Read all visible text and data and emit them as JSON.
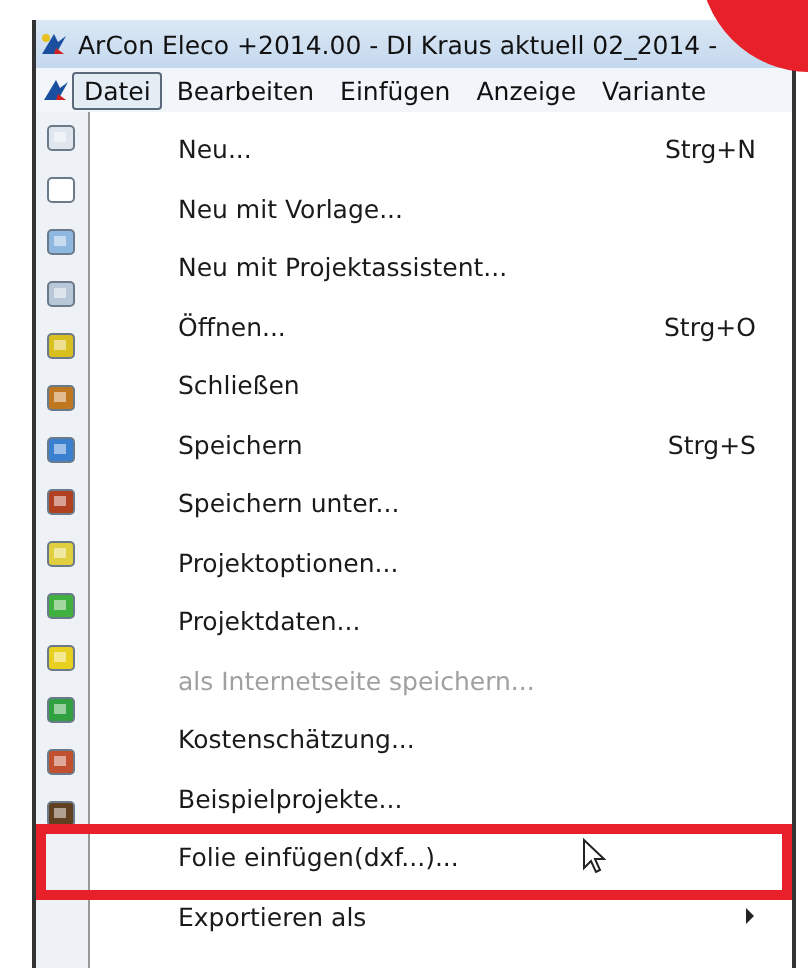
{
  "window": {
    "title": "ArCon Eleco  +2014.00 - DI Kraus aktuell 02_2014 -"
  },
  "menubar": [
    {
      "label": "Datei",
      "selected": true
    },
    {
      "label": "Bearbeiten",
      "selected": false
    },
    {
      "label": "Einfügen",
      "selected": false
    },
    {
      "label": "Anzeige",
      "selected": false
    },
    {
      "label": "Variante",
      "selected": false
    }
  ],
  "menu": [
    {
      "label": "Neu...",
      "shortcut": "Strg+N",
      "disabled": false,
      "highlighted": false,
      "submenu": false
    },
    {
      "label": "Neu mit Vorlage...",
      "disabled": false,
      "highlighted": false,
      "submenu": false
    },
    {
      "label": "Neu mit Projektassistent...",
      "disabled": false,
      "highlighted": false,
      "submenu": false
    },
    {
      "label": "Öffnen...",
      "shortcut": "Strg+O",
      "disabled": false,
      "highlighted": false,
      "submenu": false
    },
    {
      "label": "Schließen",
      "disabled": false,
      "highlighted": false,
      "submenu": false
    },
    {
      "label": "Speichern",
      "shortcut": "Strg+S",
      "disabled": false,
      "highlighted": false,
      "submenu": false
    },
    {
      "label": "Speichern unter...",
      "disabled": false,
      "highlighted": false,
      "submenu": false
    },
    {
      "label": "Projektoptionen...",
      "disabled": false,
      "highlighted": false,
      "submenu": false
    },
    {
      "label": "Projektdaten...",
      "disabled": false,
      "highlighted": false,
      "submenu": false
    },
    {
      "label": "als Internetseite speichern...",
      "disabled": true,
      "highlighted": false,
      "submenu": false
    },
    {
      "label": "Kostenschätzung...",
      "disabled": false,
      "highlighted": false,
      "submenu": false
    },
    {
      "label": "Beispielprojekte...",
      "disabled": false,
      "highlighted": false,
      "submenu": false
    },
    {
      "label": "Folie einfügen(dxf...)...",
      "disabled": false,
      "highlighted": true,
      "submenu": false
    },
    {
      "label": "Exportieren als",
      "disabled": false,
      "highlighted": false,
      "submenu": true
    }
  ]
}
